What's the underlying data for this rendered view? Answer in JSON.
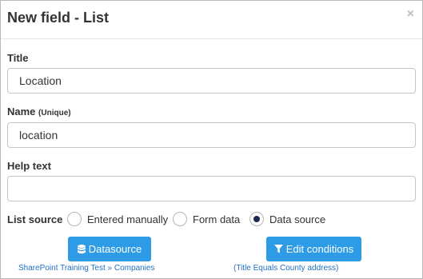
{
  "dialog": {
    "title": "New field - List",
    "close_glyph": "×"
  },
  "fields": {
    "title": {
      "label": "Title",
      "value": "Location"
    },
    "name": {
      "label": "Name",
      "hint": "(Unique)",
      "value": "location"
    },
    "help_text": {
      "label": "Help text",
      "value": ""
    }
  },
  "list_source": {
    "label": "List source",
    "options": [
      {
        "label": "Entered manually",
        "checked": false
      },
      {
        "label": "Form data",
        "checked": false
      },
      {
        "label": "Data source",
        "checked": true
      }
    ]
  },
  "actions": {
    "datasource": {
      "icon": "database-icon",
      "label": "Datasource",
      "link_text": "SharePoint Training Test » Companies"
    },
    "edit_conditions": {
      "icon": "filter-icon",
      "label": "Edit conditions",
      "link_text": "(Title Equals County address)"
    }
  },
  "colors": {
    "accent": "#2d9be6",
    "link": "#2271c3",
    "radio_checked": "#1b2a52"
  }
}
